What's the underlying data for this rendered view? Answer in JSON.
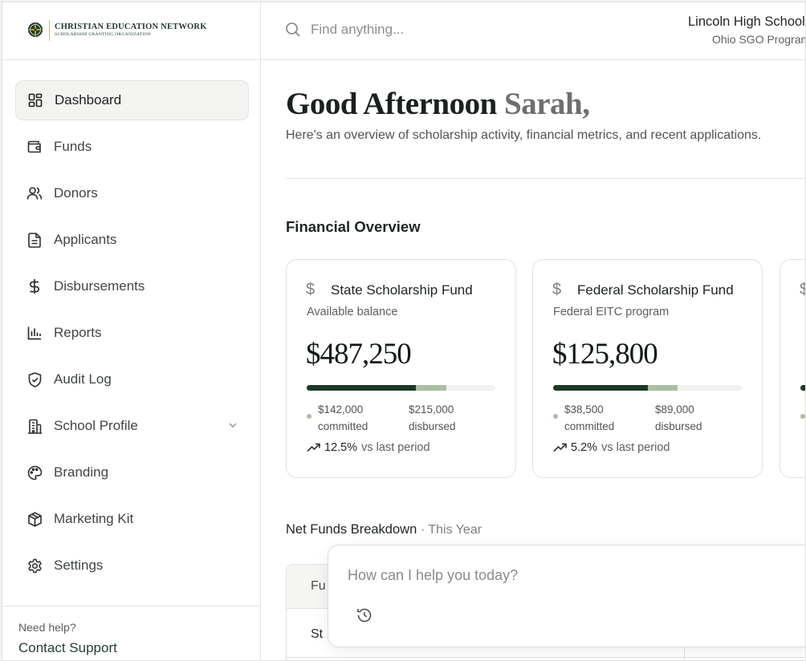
{
  "brand": {
    "title": "CHRISTIAN EDUCATION NETWORK",
    "subtitle": "SCHOLARSHIP GRANTING ORGANIZATION"
  },
  "sidebar": {
    "items": [
      {
        "label": "Dashboard",
        "icon": "grid-icon",
        "active": true
      },
      {
        "label": "Funds",
        "icon": "wallet-icon"
      },
      {
        "label": "Donors",
        "icon": "users-icon"
      },
      {
        "label": "Applicants",
        "icon": "document-icon"
      },
      {
        "label": "Disbursements",
        "icon": "dollar-icon"
      },
      {
        "label": "Reports",
        "icon": "bar-chart-icon"
      },
      {
        "label": "Audit Log",
        "icon": "shield-check-icon"
      },
      {
        "label": "School Profile",
        "icon": "building-icon",
        "expandable": true
      },
      {
        "label": "Branding",
        "icon": "palette-icon"
      },
      {
        "label": "Marketing Kit",
        "icon": "package-icon"
      },
      {
        "label": "Settings",
        "icon": "gear-icon"
      }
    ],
    "help_label": "Need help?",
    "help_link": "Contact Support"
  },
  "header": {
    "search_placeholder": "Find anything...",
    "school_name": "Lincoln High School",
    "school_program": "Ohio SGO Program"
  },
  "main": {
    "greeting_prefix": "Good Afternoon",
    "greeting_name": "Sarah,",
    "subtitle": "Here's an overview of scholarship activity, financial metrics, and recent applications.",
    "financial_title": "Financial Overview",
    "cards": [
      {
        "title": "State Scholarship Fund",
        "sub": "Available balance",
        "amount": "$487,250",
        "committed_value": "$142,000",
        "committed_label": "committed",
        "disbursed_value": "$215,000",
        "disbursed_label": "disbursed",
        "trend": "12.5%",
        "trend_label": "vs last period",
        "bar_primary": 0.58,
        "bar_secondary": 0.16
      },
      {
        "title": "Federal Scholarship Fund",
        "sub": "Federal EITC program",
        "amount": "$125,800",
        "committed_value": "$38,500",
        "committed_label": "committed",
        "disbursed_value": "$89,000",
        "disbursed_label": "disbursed",
        "trend": "5.2%",
        "trend_label": "vs last period",
        "bar_primary": 0.5,
        "bar_secondary": 0.16
      }
    ],
    "breakdown_title": "Net Funds Breakdown",
    "breakdown_period": "· This Year",
    "table_header": "Fu",
    "table_row": "St"
  },
  "chat": {
    "placeholder": "How can I help you today?"
  },
  "colors": {
    "accent_dark": "#1a3a26",
    "accent_light": "#a8bfa2"
  }
}
